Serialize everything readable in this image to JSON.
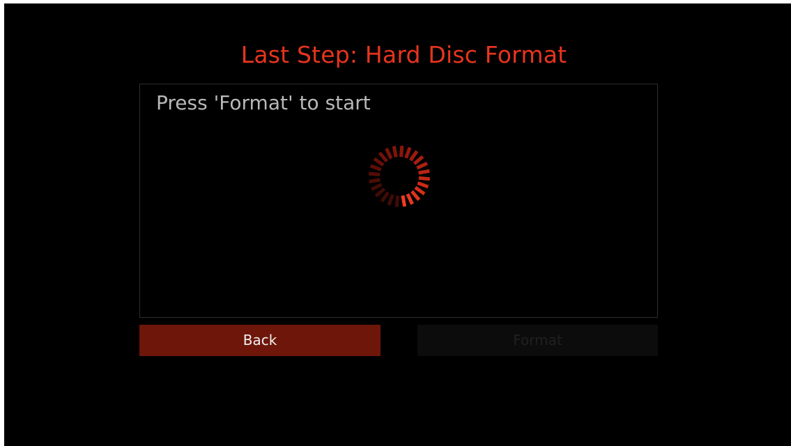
{
  "title": "Last Step: Hard Disc Format",
  "panel": {
    "message": "Press 'Format' to start"
  },
  "buttons": {
    "back_label": "Back",
    "format_label": "Format"
  },
  "colors": {
    "accent": "#e8341e",
    "back_button": "#6e1609",
    "background": "#000000"
  },
  "spinner": {
    "icon": "loading-spinner-icon"
  }
}
